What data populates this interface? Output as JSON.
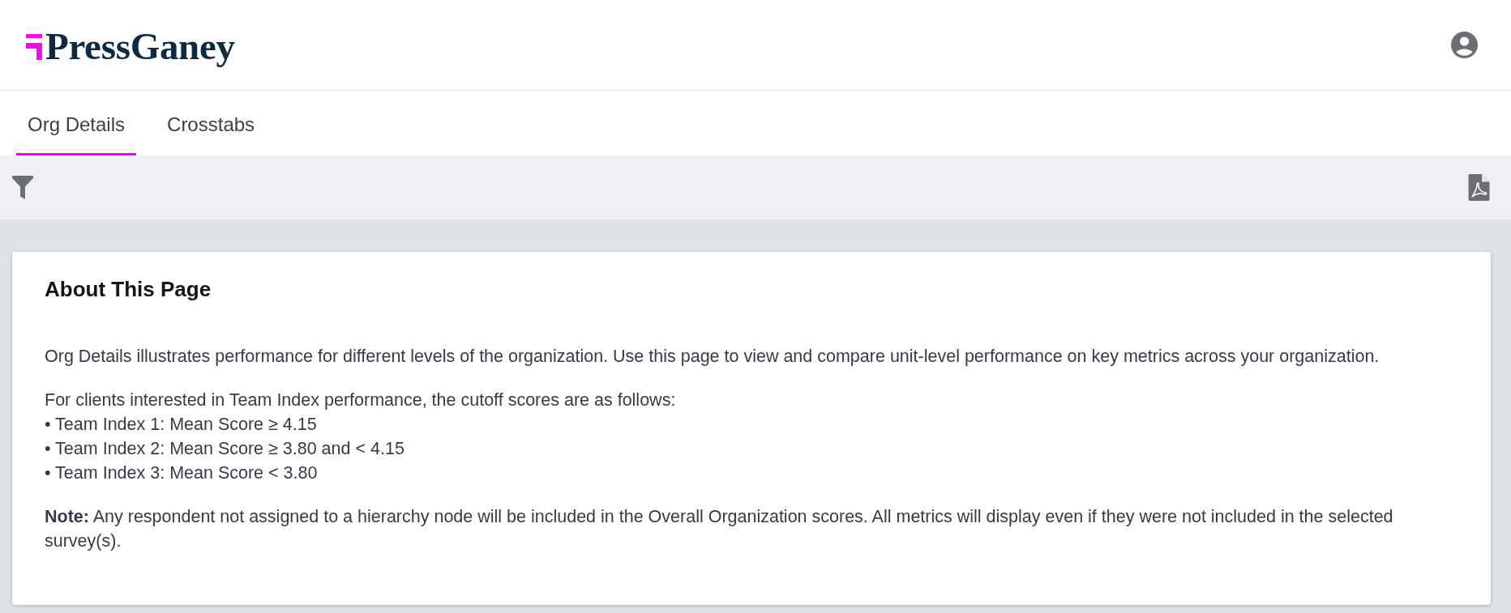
{
  "header": {
    "logo": {
      "text": "PressGaney"
    }
  },
  "tabs": [
    {
      "label": "Org Details",
      "selected": true
    },
    {
      "label": "Crosstabs",
      "selected": false
    }
  ],
  "about": {
    "title": "About This Page",
    "intro": "Org Details illustrates performance for different levels of the organization. Use this page to view and compare unit-level performance on key metrics across your organization.",
    "cutoffs": {
      "lead": "For clients interested in Team Index performance, the cutoff scores are as follows:",
      "items": [
        "• Team Index 1: Mean Score ≥ 4.15",
        "• Team Index 2: Mean Score ≥ 3.80 and < 4.15",
        "• Team Index 3: Mean Score < 3.80"
      ]
    },
    "note": "**Note:** Any respondent not assigned to a hierarchy node will be included in the Overall Organization scores. All metrics will display even if they were not included in the selected survey(s)."
  }
}
